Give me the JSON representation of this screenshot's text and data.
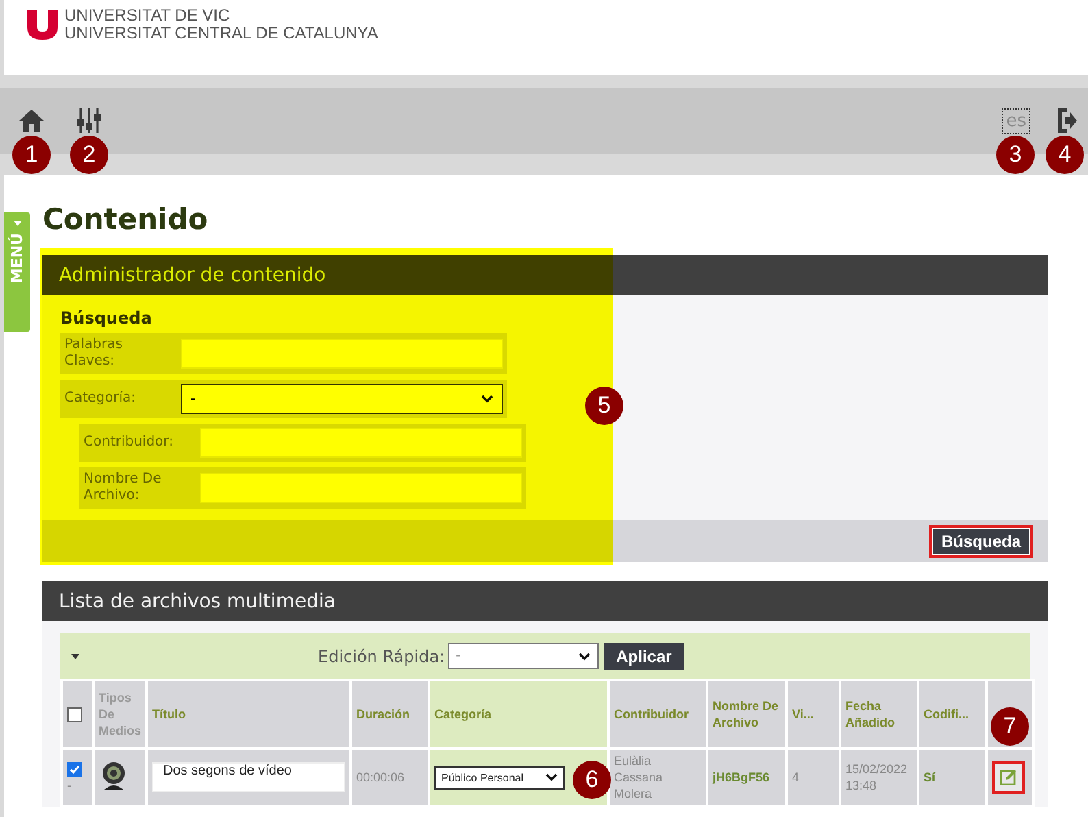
{
  "header": {
    "logo_lines": [
      "UNIVERSITAT DE VIC",
      "UNIVERSITAT CENTRAL DE CATALUNYA"
    ]
  },
  "toolbar": {
    "language": "es"
  },
  "menu_tab": {
    "label": "MENÚ"
  },
  "page_title": "Contenido",
  "search_panel": {
    "title": "Administrador de contenido",
    "section": "Búsqueda",
    "annotation_highlight": true,
    "fields": [
      {
        "kind": "text",
        "label": "Palabras Claves:"
      },
      {
        "kind": "select",
        "label": "Categoría:",
        "value": "-"
      }
    ],
    "extra_fields": [
      {
        "kind": "text",
        "label": "Contribuidor:"
      },
      {
        "kind": "text",
        "label": "Nombre De Archivo:"
      }
    ],
    "search_button": {
      "label": "Búsqueda",
      "highlighted": true
    }
  },
  "media_panel": {
    "title": "Lista de archivos multimedia",
    "quick_edit": {
      "label": "Edición Rápida:",
      "value": "-",
      "apply_button": "Aplicar"
    },
    "table": {
      "columns": [
        {
          "kind": "checkbox",
          "checked": false,
          "highlighted": false
        },
        {
          "kind": "text",
          "label": "Tipos De Medios",
          "highlighted": false
        },
        {
          "kind": "text",
          "label": "Título",
          "highlighted": false
        },
        {
          "kind": "text",
          "label": "Duración",
          "highlighted": false
        },
        {
          "kind": "text",
          "label": "Categoría",
          "highlighted": true
        },
        {
          "kind": "text",
          "label": "Contribuidor",
          "highlighted": false
        },
        {
          "kind": "text",
          "label": "Nombre De Archivo",
          "highlighted": false
        },
        {
          "kind": "text",
          "label": "Vi...",
          "highlighted": false
        },
        {
          "kind": "text",
          "label": "Fecha Añadido",
          "highlighted": false
        },
        {
          "kind": "text",
          "label": "Codifi...",
          "highlighted": false
        },
        {
          "kind": "edit",
          "highlighted": false
        }
      ],
      "rows": [
        {
          "checked": true,
          "marker": "-",
          "title": "Dos segons de vídeo",
          "duration": "00:00:06",
          "category": "Público Personal",
          "contributor": "Eulàlia Cassana Molera",
          "file_name": "jH6BgF56",
          "views": "4",
          "date_added": "15/02/2022 13:48",
          "encoded": "Sí",
          "edit_highlighted": true
        }
      ]
    }
  },
  "annotation_badges": [
    "1",
    "2",
    "3",
    "4",
    "5",
    "6",
    "7"
  ]
}
